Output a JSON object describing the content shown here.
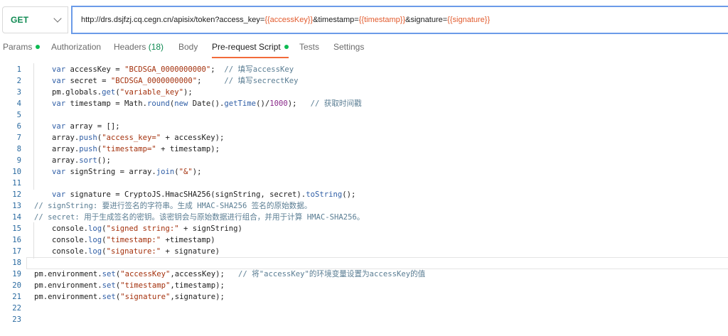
{
  "request": {
    "method": "GET",
    "url_parts": [
      {
        "t": "txt",
        "v": "http://drs.dsjfzj.cq.cegn.cn/apisix/token?access_key="
      },
      {
        "t": "var",
        "v": "{{accessKey}}"
      },
      {
        "t": "txt",
        "v": "&timestamp="
      },
      {
        "t": "var",
        "v": "{{timestamp}}"
      },
      {
        "t": "txt",
        "v": "&signature="
      },
      {
        "t": "var",
        "v": "{{signature}}"
      }
    ]
  },
  "tabs": [
    {
      "label": "Params",
      "dot": true,
      "count": "",
      "active": false
    },
    {
      "label": "Authorization",
      "dot": false,
      "count": "",
      "active": false
    },
    {
      "label": "Headers",
      "dot": false,
      "count": "(18)",
      "active": false
    },
    {
      "label": "Body",
      "dot": false,
      "count": "",
      "active": false
    },
    {
      "label": "Pre-request Script",
      "dot": true,
      "count": "",
      "active": true
    },
    {
      "label": "Tests",
      "dot": false,
      "count": "",
      "active": false
    },
    {
      "label": "Settings",
      "dot": false,
      "count": "",
      "active": false
    }
  ],
  "colors": {
    "accent": "#f26b3a",
    "method_green": "#0f8a52",
    "dot_green": "#0cbb52",
    "url_var": "#e25b2e"
  },
  "editor": {
    "lines": [
      {
        "num": "1",
        "indent": 1,
        "tokens": [
          [
            "k",
            "var"
          ],
          [
            "p",
            " accessKey = "
          ],
          [
            "s",
            "\"BCDSGA_0000000000\""
          ],
          [
            "p",
            ";  "
          ],
          [
            "c",
            "// 填写accessKey"
          ]
        ]
      },
      {
        "num": "2",
        "indent": 1,
        "tokens": [
          [
            "k",
            "var"
          ],
          [
            "p",
            " secret = "
          ],
          [
            "s",
            "\"BCDSGA_0000000000\""
          ],
          [
            "p",
            ";     "
          ],
          [
            "c",
            "// 填写secrectKey"
          ]
        ]
      },
      {
        "num": "3",
        "indent": 1,
        "tokens": [
          [
            "p",
            "pm.globals."
          ],
          [
            "k",
            "get"
          ],
          [
            "p",
            "("
          ],
          [
            "s",
            "\"variable_key\""
          ],
          [
            "p",
            ");"
          ]
        ]
      },
      {
        "num": "4",
        "indent": 1,
        "tokens": [
          [
            "k",
            "var"
          ],
          [
            "p",
            " timestamp = Math."
          ],
          [
            "k",
            "round"
          ],
          [
            "p",
            "("
          ],
          [
            "k",
            "new"
          ],
          [
            "p",
            " Date()."
          ],
          [
            "k",
            "getTime"
          ],
          [
            "p",
            "()/"
          ],
          [
            "n",
            "1000"
          ],
          [
            "p",
            ");   "
          ],
          [
            "c",
            "// 获取时间戳"
          ]
        ]
      },
      {
        "num": "5",
        "indent": 0,
        "tokens": []
      },
      {
        "num": "6",
        "indent": 1,
        "tokens": [
          [
            "k",
            "var"
          ],
          [
            "p",
            " array = [];"
          ]
        ]
      },
      {
        "num": "7",
        "indent": 1,
        "tokens": [
          [
            "p",
            "array."
          ],
          [
            "k",
            "push"
          ],
          [
            "p",
            "("
          ],
          [
            "s",
            "\"access_key=\""
          ],
          [
            "p",
            " + accessKey);"
          ]
        ]
      },
      {
        "num": "8",
        "indent": 1,
        "tokens": [
          [
            "p",
            "array."
          ],
          [
            "k",
            "push"
          ],
          [
            "p",
            "("
          ],
          [
            "s",
            "\"timestamp=\""
          ],
          [
            "p",
            " + timestamp);"
          ]
        ]
      },
      {
        "num": "9",
        "indent": 1,
        "tokens": [
          [
            "p",
            "array."
          ],
          [
            "k",
            "sort"
          ],
          [
            "p",
            "();"
          ]
        ]
      },
      {
        "num": "10",
        "indent": 1,
        "tokens": [
          [
            "k",
            "var"
          ],
          [
            "p",
            " signString = array."
          ],
          [
            "k",
            "join"
          ],
          [
            "p",
            "("
          ],
          [
            "s",
            "\"&\""
          ],
          [
            "p",
            ");"
          ]
        ]
      },
      {
        "num": "11",
        "indent": 0,
        "tokens": []
      },
      {
        "num": "12",
        "indent": 1,
        "tokens": [
          [
            "k",
            "var"
          ],
          [
            "p",
            " signature = CryptoJS.HmacSHA256(signString, secret)."
          ],
          [
            "k",
            "toString"
          ],
          [
            "p",
            "();"
          ]
        ]
      },
      {
        "num": "13",
        "indent": 0,
        "tokens": [
          [
            "c",
            "// signString: 要进行签名的字符串。生成 HMAC-SHA256 签名的原始数据。"
          ]
        ]
      },
      {
        "num": "14",
        "indent": 0,
        "tokens": [
          [
            "c",
            "// secret: 用于生成签名的密钥。该密钥会与原始数据进行组合，并用于计算 HMAC-SHA256。"
          ]
        ]
      },
      {
        "num": "15",
        "indent": 1,
        "tokens": [
          [
            "p",
            "console."
          ],
          [
            "k",
            "log"
          ],
          [
            "p",
            "("
          ],
          [
            "s",
            "\"signed string:\""
          ],
          [
            "p",
            " + signString)"
          ]
        ]
      },
      {
        "num": "16",
        "indent": 1,
        "tokens": [
          [
            "p",
            "console."
          ],
          [
            "k",
            "log"
          ],
          [
            "p",
            "("
          ],
          [
            "s",
            "\"timestamp:\""
          ],
          [
            "p",
            " +timestamp)"
          ]
        ]
      },
      {
        "num": "17",
        "indent": 1,
        "tokens": [
          [
            "p",
            "console."
          ],
          [
            "k",
            "log"
          ],
          [
            "p",
            "("
          ],
          [
            "s",
            "\"signature:\""
          ],
          [
            "p",
            " + signature)"
          ]
        ]
      },
      {
        "num": "18",
        "indent": 0,
        "tokens": []
      },
      {
        "num": "19",
        "indent": 0,
        "tokens": [
          [
            "p",
            "pm.environment."
          ],
          [
            "k",
            "set"
          ],
          [
            "p",
            "("
          ],
          [
            "s",
            "\"accessKey\""
          ],
          [
            "p",
            ",accessKey);   "
          ],
          [
            "c",
            "// 将\"accessKey\"的环境变量设置为accessKey的值"
          ]
        ]
      },
      {
        "num": "20",
        "indent": 0,
        "tokens": [
          [
            "p",
            "pm.environment."
          ],
          [
            "k",
            "set"
          ],
          [
            "p",
            "("
          ],
          [
            "s",
            "\"timestamp\""
          ],
          [
            "p",
            ",timestamp);"
          ]
        ]
      },
      {
        "num": "21",
        "indent": 0,
        "tokens": [
          [
            "p",
            "pm.environment."
          ],
          [
            "k",
            "set"
          ],
          [
            "p",
            "("
          ],
          [
            "s",
            "\"signature\""
          ],
          [
            "p",
            ",signature);"
          ]
        ]
      },
      {
        "num": "22",
        "indent": 0,
        "tokens": []
      },
      {
        "num": "23",
        "indent": 0,
        "tokens": []
      }
    ]
  }
}
